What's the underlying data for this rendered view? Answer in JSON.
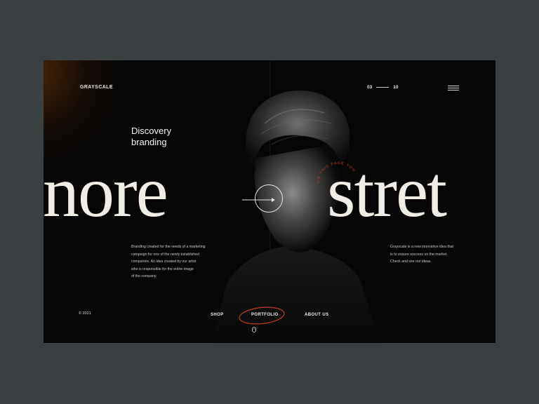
{
  "brand": {
    "name": "GRAYSCALE"
  },
  "pager": {
    "current": "03",
    "total": "10"
  },
  "hero": {
    "headline_line1": "Discovery",
    "headline_line2": "branding",
    "big_left": "nore",
    "big_right": "stret",
    "ring_text": "ON THIS PAGE YOU"
  },
  "description_left": {
    "lines": [
      "Branding created for the needs of a marketing",
      "campaign for one of the newly established",
      "companies. An idea created by our artist",
      "who is responsible for the entire image",
      "of the company."
    ]
  },
  "description_right": {
    "lines": [
      "Grayscale is a new innovative idea that",
      "is to ensure success on the market.",
      "Check and see our ideas."
    ]
  },
  "footer": {
    "copyright": "© 2021",
    "nav": {
      "shop": "SHOP",
      "portfolio": "PORTFOLIO",
      "about": "ABOUT US"
    }
  },
  "icons": {
    "menu": "hamburger-icon",
    "arrow": "arrow-right-icon",
    "scroll": "mouse-scroll-icon"
  },
  "colors": {
    "background": "#3a3f42",
    "frame": "#060606",
    "accent": "#d2411c",
    "text": "#f1ede6"
  }
}
